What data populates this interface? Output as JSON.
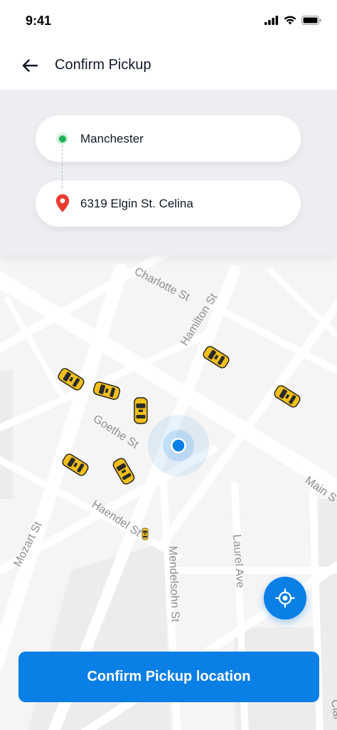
{
  "status_bar": {
    "time": "9:41"
  },
  "header": {
    "title": "Confirm Pickup"
  },
  "pickup": {
    "label": "Manchester"
  },
  "destination": {
    "label": "6319 Elgin St. Celina"
  },
  "map": {
    "streets": {
      "charlotte": "Charlotte St",
      "hamilton": "Hamilton St",
      "goethe": "Goethe St",
      "haendel": "Haendel St",
      "mozart": "Mozart St",
      "mendelsohn": "Mendelsohn St",
      "laurel": "Laurel Ave",
      "main": "Main S",
      "clark": "Clar"
    }
  },
  "actions": {
    "confirm_label": "Confirm Pickup location"
  },
  "colors": {
    "accent": "#0A7FE6",
    "pickup_green": "#22B15A",
    "destination_red": "#EA3B2E",
    "taxi_yellow": "#F2C01C"
  }
}
